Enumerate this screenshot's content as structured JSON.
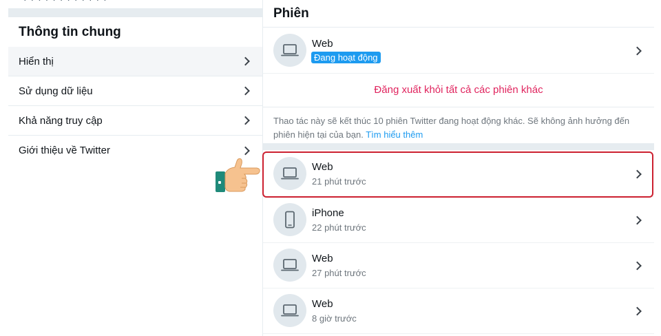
{
  "left": {
    "cut_text": "· · · · · · · · · · · ·",
    "title": "Thông tin chung",
    "items": [
      {
        "label": "Hiển thị"
      },
      {
        "label": "Sử dụng dữ liệu"
      },
      {
        "label": "Khả năng truy cập"
      },
      {
        "label": "Giới thiệu về Twitter"
      }
    ]
  },
  "right": {
    "title": "Phiên",
    "current_session": {
      "name": "Web",
      "status": "Đang hoạt động",
      "icon": "laptop-icon"
    },
    "logout_all": "Đăng xuất khỏi tất cả các phiên khác",
    "notice_text": "Thao tác này sẽ kết thúc 10 phiên Twitter đang hoạt động khác. Sẽ không ảnh hưởng đến phiên hiện tại của bạn.",
    "notice_link": "Tìm hiểu thêm",
    "sessions": [
      {
        "name": "Web",
        "time": "21 phút trước",
        "icon": "laptop-icon"
      },
      {
        "name": "iPhone",
        "time": "22 phút trước",
        "icon": "phone-icon"
      },
      {
        "name": "Web",
        "time": "27 phút trước",
        "icon": "laptop-icon"
      },
      {
        "name": "Web",
        "time": "8 giờ trước",
        "icon": "laptop-icon"
      }
    ]
  },
  "colors": {
    "accent": "#1d9bf0",
    "danger": "#e0245e",
    "highlight_border": "#cc1f2f"
  }
}
